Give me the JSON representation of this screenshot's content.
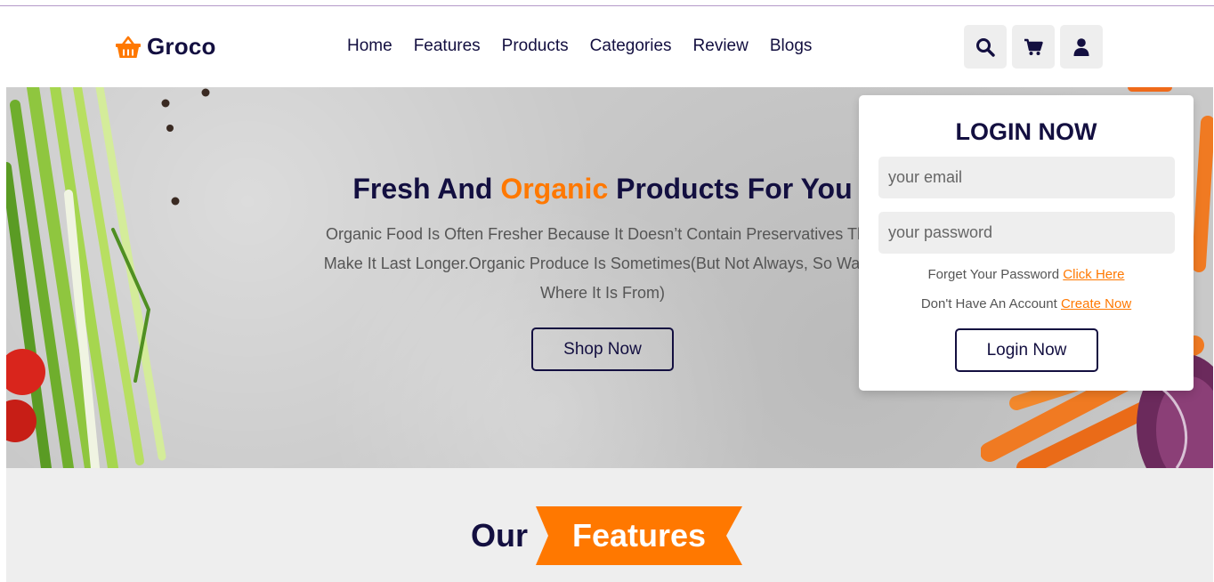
{
  "brand": {
    "name": "Groco",
    "accent_color": "#ff7800",
    "text_color": "#130f40",
    "logo_icon": "shopping-basket-icon"
  },
  "nav": {
    "items": [
      {
        "label": "Home"
      },
      {
        "label": "Features"
      },
      {
        "label": "Products"
      },
      {
        "label": "Categories"
      },
      {
        "label": "Review"
      },
      {
        "label": "Blogs"
      }
    ]
  },
  "header_icons": [
    "search-icon",
    "shopping-cart-icon",
    "user-icon"
  ],
  "hero": {
    "title_part1": "Fresh And ",
    "title_accent": "Organic",
    "title_part2": " Products For You",
    "description": "Organic Food Is Often Fresher Because It Doesn’t Contain Preservatives That Make It Last Longer.Organic Produce Is Sometimes(But Not Always, So Watch Where It Is From)",
    "button_label": "Shop Now"
  },
  "login": {
    "title": "LOGIN NOW",
    "email_placeholder": "your email",
    "password_placeholder": "your password",
    "forgot_text": "Forget Your Password ",
    "forgot_link": "Click Here",
    "account_text": "Don't Have An Account ",
    "account_link": "Create Now",
    "button_label": "Login Now"
  },
  "features": {
    "heading_prefix": "Our",
    "heading_ribbon": "Features"
  }
}
